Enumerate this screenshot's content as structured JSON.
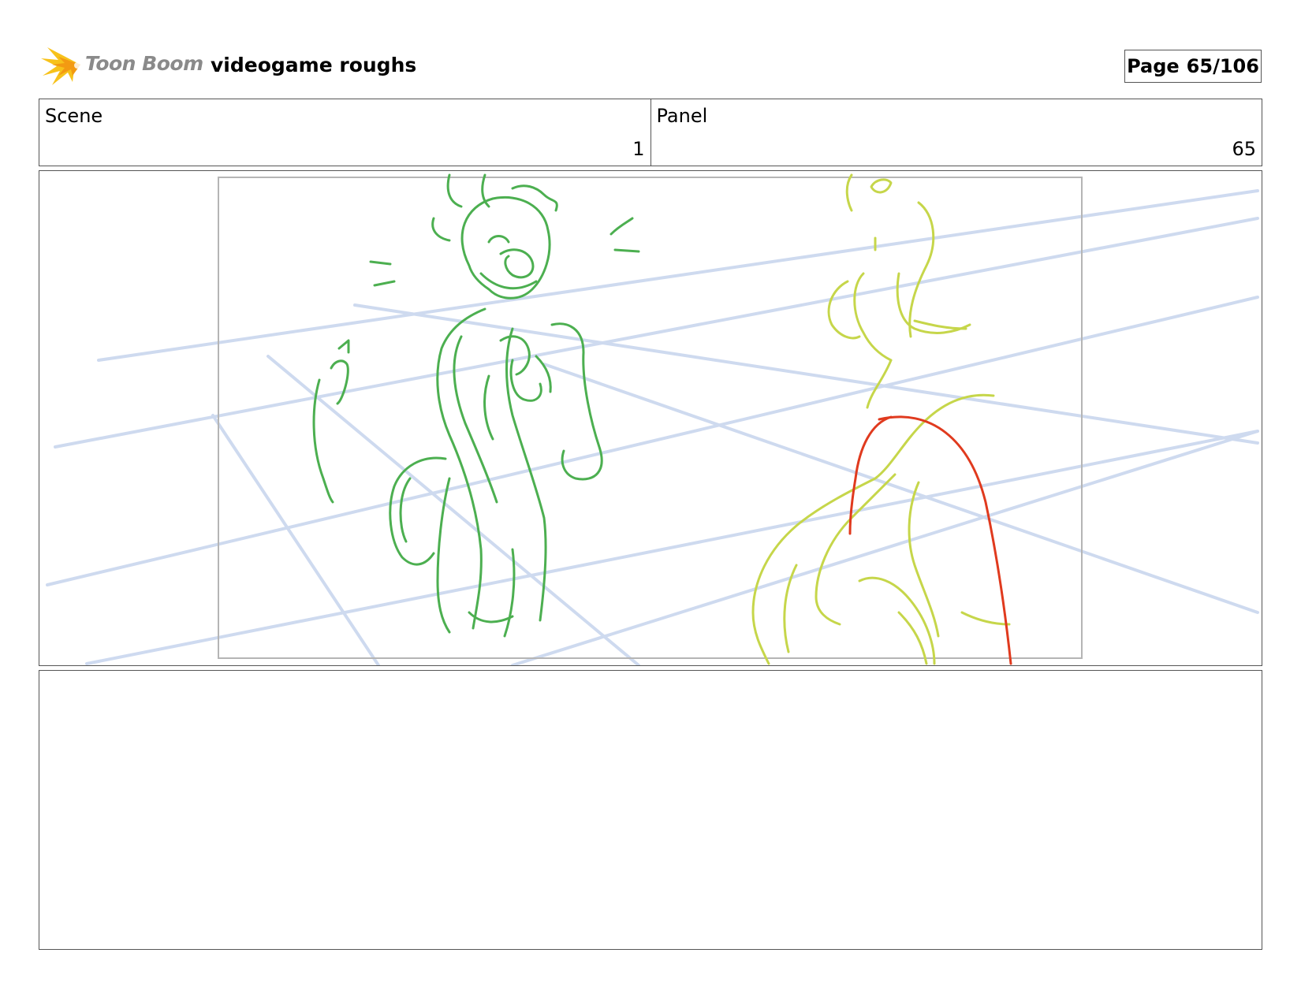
{
  "header": {
    "logo_text": "Toon Boom",
    "logo_icon": "toon-boom-starburst-logo",
    "project_title": "videogame roughs",
    "page_label": "Page",
    "page_value": "65/106"
  },
  "info": {
    "scene_label": "Scene",
    "scene_value": "1",
    "panel_label": "Panel",
    "panel_value": "65"
  },
  "sketch": {
    "description_icon": "storyboard-sketch",
    "colors": {
      "perspective_grid": "#c9d6ee",
      "left_character": "#4caf50",
      "right_character": "#c6d64a",
      "accent_stroke": "#e03a1e",
      "camera_frame": "#b5b5b5"
    }
  },
  "notes": {
    "text": ""
  }
}
